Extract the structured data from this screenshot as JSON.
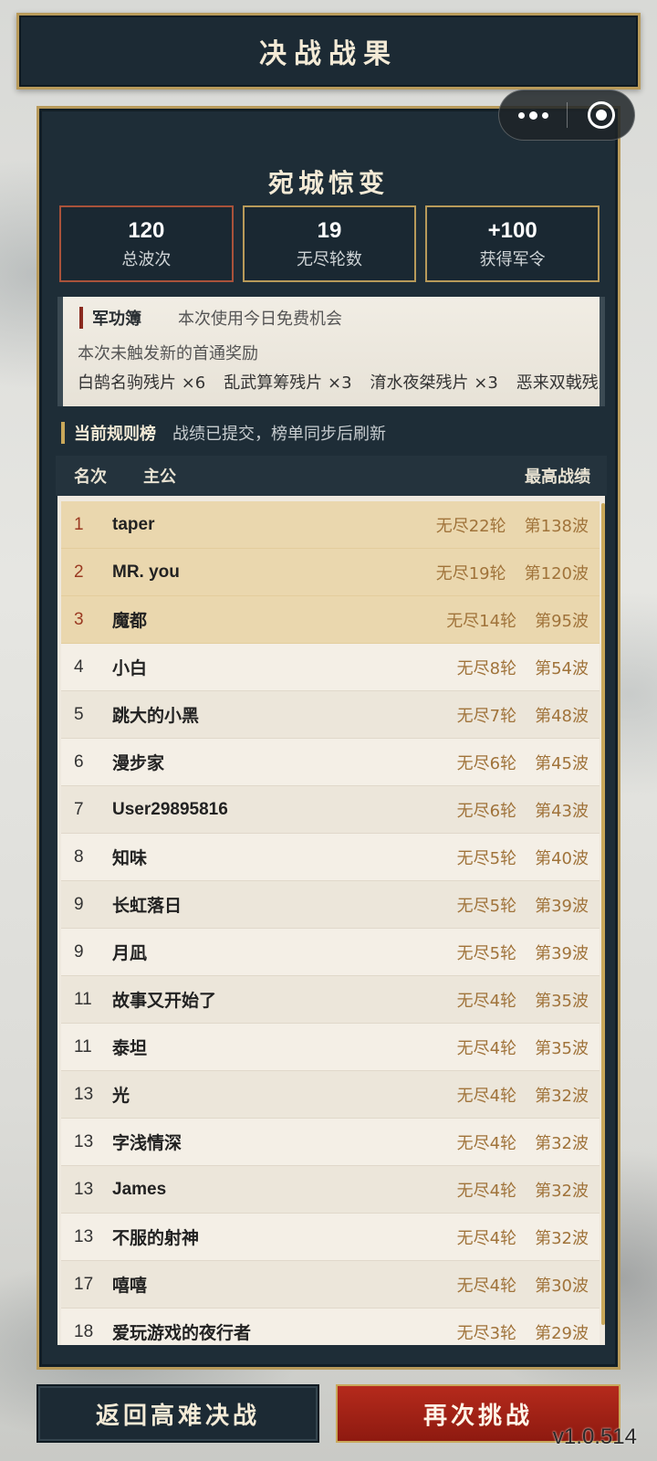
{
  "header": {
    "title": "决战战果"
  },
  "level": {
    "name": "宛城惊变"
  },
  "stats": [
    {
      "value": "120",
      "label": "总波次"
    },
    {
      "value": "19",
      "label": "无尽轮数"
    },
    {
      "value": "+100",
      "label": "获得军令"
    }
  ],
  "merit": {
    "title": "军功簿",
    "note": "本次使用今日免费机会",
    "first_clear": "本次未触发新的首通奖励",
    "rewards": [
      "白鹄名驹残片 ×6",
      "乱武算筹残片 ×3",
      "淯水夜桀残片 ×3",
      "恶来双戟残片"
    ]
  },
  "leaderboard": {
    "title": "当前规则榜",
    "subtitle": "战绩已提交，榜单同步后刷新",
    "col_rank": "名次",
    "col_name": "主公",
    "col_best": "最高战绩",
    "rows": [
      {
        "rank": "1",
        "name": "taper",
        "endless": "无尽22轮",
        "wave": "第138波"
      },
      {
        "rank": "2",
        "name": "MR. you",
        "endless": "无尽19轮",
        "wave": "第120波"
      },
      {
        "rank": "3",
        "name": "魔都",
        "endless": "无尽14轮",
        "wave": "第95波"
      },
      {
        "rank": "4",
        "name": "小白",
        "endless": "无尽8轮",
        "wave": "第54波"
      },
      {
        "rank": "5",
        "name": "跳大的小黑",
        "endless": "无尽7轮",
        "wave": "第48波"
      },
      {
        "rank": "6",
        "name": "漫步家",
        "endless": "无尽6轮",
        "wave": "第45波"
      },
      {
        "rank": "7",
        "name": "User29895816",
        "endless": "无尽6轮",
        "wave": "第43波"
      },
      {
        "rank": "8",
        "name": "知味",
        "endless": "无尽5轮",
        "wave": "第40波"
      },
      {
        "rank": "9",
        "name": "长虹落日",
        "endless": "无尽5轮",
        "wave": "第39波"
      },
      {
        "rank": "9",
        "name": "月凪",
        "endless": "无尽5轮",
        "wave": "第39波"
      },
      {
        "rank": "11",
        "name": "故事又开始了",
        "endless": "无尽4轮",
        "wave": "第35波"
      },
      {
        "rank": "11",
        "name": "泰坦",
        "endless": "无尽4轮",
        "wave": "第35波"
      },
      {
        "rank": "13",
        "name": "光",
        "endless": "无尽4轮",
        "wave": "第32波"
      },
      {
        "rank": "13",
        "name": "字浅情深",
        "endless": "无尽4轮",
        "wave": "第32波"
      },
      {
        "rank": "13",
        "name": "James",
        "endless": "无尽4轮",
        "wave": "第32波"
      },
      {
        "rank": "13",
        "name": "不服的射神",
        "endless": "无尽4轮",
        "wave": "第32波"
      },
      {
        "rank": "17",
        "name": "嘻嘻",
        "endless": "无尽4轮",
        "wave": "第30波"
      },
      {
        "rank": "18",
        "name": "爱玩游戏的夜行者",
        "endless": "无尽3轮",
        "wave": "第29波"
      }
    ]
  },
  "buttons": {
    "back": "返回高难决战",
    "retry": "再次挑战"
  },
  "version": "v1.0.514"
}
